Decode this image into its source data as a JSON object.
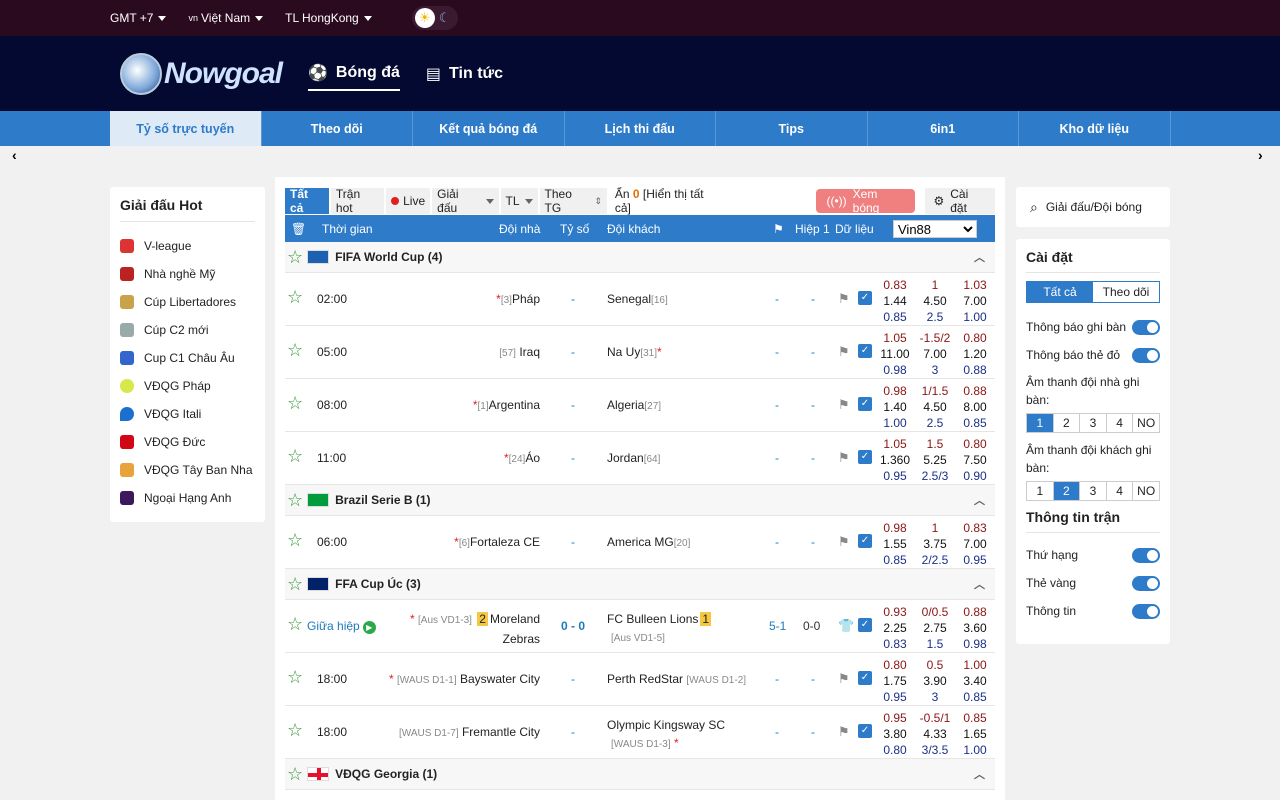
{
  "topbar": {
    "timezone": "GMT +7",
    "language_flag": "vn",
    "language": "Việt Nam",
    "odds_type": "TL HongKong"
  },
  "header": {
    "logo_text": "Nowgoal",
    "nav": [
      "Bóng đá",
      "Tin tức"
    ]
  },
  "tabs": [
    "Tỷ số trực tuyến",
    "Theo dõi",
    "Kết quả bóng đá",
    "Lịch thi đấu",
    "Tips",
    "6in1",
    "Kho dữ liệu"
  ],
  "left": {
    "title": "Giải đấu Hot",
    "items": [
      "V-league",
      "Nhà nghề Mỹ",
      "Cúp Libertadores",
      "Cúp C2 mới",
      "Cup C1 Châu Âu",
      "VĐQG Pháp",
      "VĐQG Itali",
      "VĐQG Đức",
      "VĐQG Tây Ban Nha",
      "Ngoại Hạng Anh"
    ]
  },
  "filters": {
    "all": "Tất cả",
    "hot": "Trận hot",
    "live": "Live",
    "league": "Giải đấu",
    "tl": "TL",
    "theo_tg": "Theo TG",
    "hide_prefix": "Ẩn",
    "hide_count": "0",
    "hide_suffix": "[Hiển thị tất cả]",
    "watch": "Xem bóng",
    "settings": "Cài đặt"
  },
  "thead": {
    "time": "Thời gian",
    "home": "Đội nhà",
    "score": "Tỷ số",
    "away": "Đội khách",
    "half": "Hiệp 1",
    "data": "Dữ liệu",
    "bookmaker": "Vin88"
  },
  "groups": [
    {
      "name": "FIFA World Cup (4)",
      "flag": "fifa"
    },
    {
      "name": "Brazil Serie B (1)",
      "flag": "brazil"
    },
    {
      "name": "FFA Cup Úc (3)",
      "flag": "australia"
    },
    {
      "name": "VĐQG Georgia (1)",
      "flag": "georgia"
    }
  ],
  "matches": [
    {
      "time": "02:00",
      "home_rank": "[3]",
      "home": "Pháp",
      "score": "-",
      "away": "Senegal",
      "away_rank": "[16]",
      "ht": "-",
      "ht2": "-",
      "odds": [
        [
          "0.83",
          "1",
          "1.03"
        ],
        [
          "1.44",
          "4.50",
          "7.00"
        ],
        [
          "0.85",
          "2.5",
          "1.00"
        ]
      ]
    },
    {
      "time": "05:00",
      "home_rank": "[57]",
      "home": "Iraq",
      "score": "-",
      "away": "Na Uy",
      "away_rank": "[31]",
      "ht": "-",
      "ht2": "-",
      "odds": [
        [
          "1.05",
          "-1.5/2",
          "0.80"
        ],
        [
          "11.00",
          "7.00",
          "1.20"
        ],
        [
          "0.98",
          "3",
          "0.88"
        ]
      ]
    },
    {
      "time": "08:00",
      "home_rank": "[1]",
      "home": "Argentina",
      "score": "-",
      "away": "Algeria",
      "away_rank": "[27]",
      "ht": "-",
      "ht2": "-",
      "odds": [
        [
          "0.98",
          "1/1.5",
          "0.88"
        ],
        [
          "1.40",
          "4.50",
          "8.00"
        ],
        [
          "1.00",
          "2.5",
          "0.85"
        ]
      ]
    },
    {
      "time": "11:00",
      "home_rank": "[24]",
      "home": "Áo",
      "score": "-",
      "away": "Jordan",
      "away_rank": "[64]",
      "ht": "-",
      "ht2": "-",
      "odds": [
        [
          "1.05",
          "1.5",
          "0.80"
        ],
        [
          "1.360",
          "5.25",
          "7.50"
        ],
        [
          "0.95",
          "2.5/3",
          "0.90"
        ]
      ]
    },
    {
      "time": "06:00",
      "home_rank": "[6]",
      "home": "Fortaleza CE",
      "score": "-",
      "away": "America MG",
      "away_rank": "[20]",
      "ht": "-",
      "ht2": "-",
      "odds": [
        [
          "0.98",
          "1",
          "0.83"
        ],
        [
          "1.55",
          "3.75",
          "7.00"
        ],
        [
          "0.85",
          "2/2.5",
          "0.95"
        ]
      ]
    },
    {
      "time": "Giữa hiệp",
      "home_rank": "[Aus VD1-3]",
      "home_red": "2",
      "home": "Moreland Zebras",
      "score": "0 - 0",
      "away": "FC Bulleen Lions",
      "away_red": "1",
      "away_rank": "[Aus VD1-5]",
      "ht": "5-1",
      "ht2": "0-0",
      "odds": [
        [
          "0.93",
          "0/0.5",
          "0.88"
        ],
        [
          "2.25",
          "2.75",
          "3.60"
        ],
        [
          "0.83",
          "1.5",
          "0.98"
        ]
      ]
    },
    {
      "time": "18:00",
      "home_rank": "[WAUS D1-1]",
      "home": "Bayswater City",
      "score": "-",
      "away": "Perth RedStar",
      "away_rank": "[WAUS D1-2]",
      "ht": "-",
      "ht2": "-",
      "odds": [
        [
          "0.80",
          "0.5",
          "1.00"
        ],
        [
          "1.75",
          "3.90",
          "3.40"
        ],
        [
          "0.95",
          "3",
          "0.85"
        ]
      ]
    },
    {
      "time": "18:00",
      "home_rank": "[WAUS D1-7]",
      "home": "Fremantle City",
      "score": "-",
      "away": "Olympic Kingsway SC",
      "away_rank": "[WAUS D1-3]",
      "ht": "-",
      "ht2": "-",
      "odds": [
        [
          "0.95",
          "-0.5/1",
          "0.85"
        ],
        [
          "3.80",
          "4.33",
          "1.65"
        ],
        [
          "0.80",
          "3/3.5",
          "1.00"
        ]
      ]
    }
  ],
  "right": {
    "search": "Giải đấu/Đội bóng",
    "settings_title": "Cài đặt",
    "seg": [
      "Tất cả",
      "Theo dõi"
    ],
    "goal_notice": "Thông báo ghi bàn",
    "card_notice": "Thông báo thẻ đỏ",
    "home_sound": "Âm thanh đội nhà ghi bàn:",
    "away_sound": "Âm thanh đội khách ghi bàn:",
    "nums": [
      "1",
      "2",
      "3",
      "4",
      "NO"
    ],
    "match_info": "Thông tin trận",
    "rank": "Thứ hạng",
    "yellow": "Thẻ vàng",
    "info": "Thông tin"
  }
}
